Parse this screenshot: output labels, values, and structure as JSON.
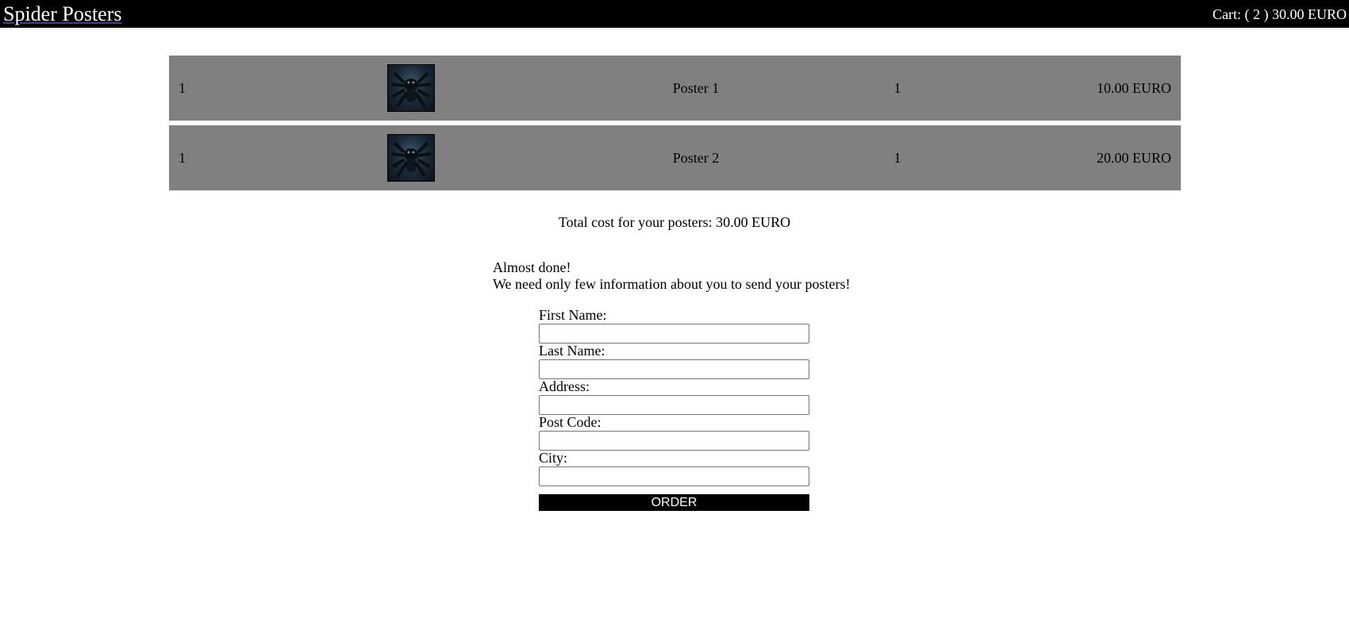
{
  "header": {
    "brand": "Spider Posters",
    "cart": "Cart: ( 2 ) 30.00 EURO"
  },
  "cart_items": [
    {
      "index": "1",
      "name": "Poster 1",
      "quantity": "1",
      "price": "10.00 EURO",
      "thumbnail_icon": "spider-poster-thumbnail"
    },
    {
      "index": "1",
      "name": "Poster 2",
      "quantity": "1",
      "price": "20.00 EURO",
      "thumbnail_icon": "spider-poster-thumbnail"
    }
  ],
  "total": "Total cost for your posters: 30.00 EURO",
  "intro": {
    "line1": "Almost done!",
    "line2": "We need only few information about you to send your posters!"
  },
  "form": {
    "first_name_label": "First Name:",
    "first_name_value": "",
    "last_name_label": "Last Name:",
    "last_name_value": "",
    "address_label": "Address:",
    "address_value": "",
    "post_code_label": "Post Code:",
    "post_code_value": "",
    "city_label": "City:",
    "city_value": "",
    "order_label": "ORDER"
  },
  "colors": {
    "header_bg": "#000000",
    "row_bg": "#808080",
    "button_bg": "#000000"
  }
}
